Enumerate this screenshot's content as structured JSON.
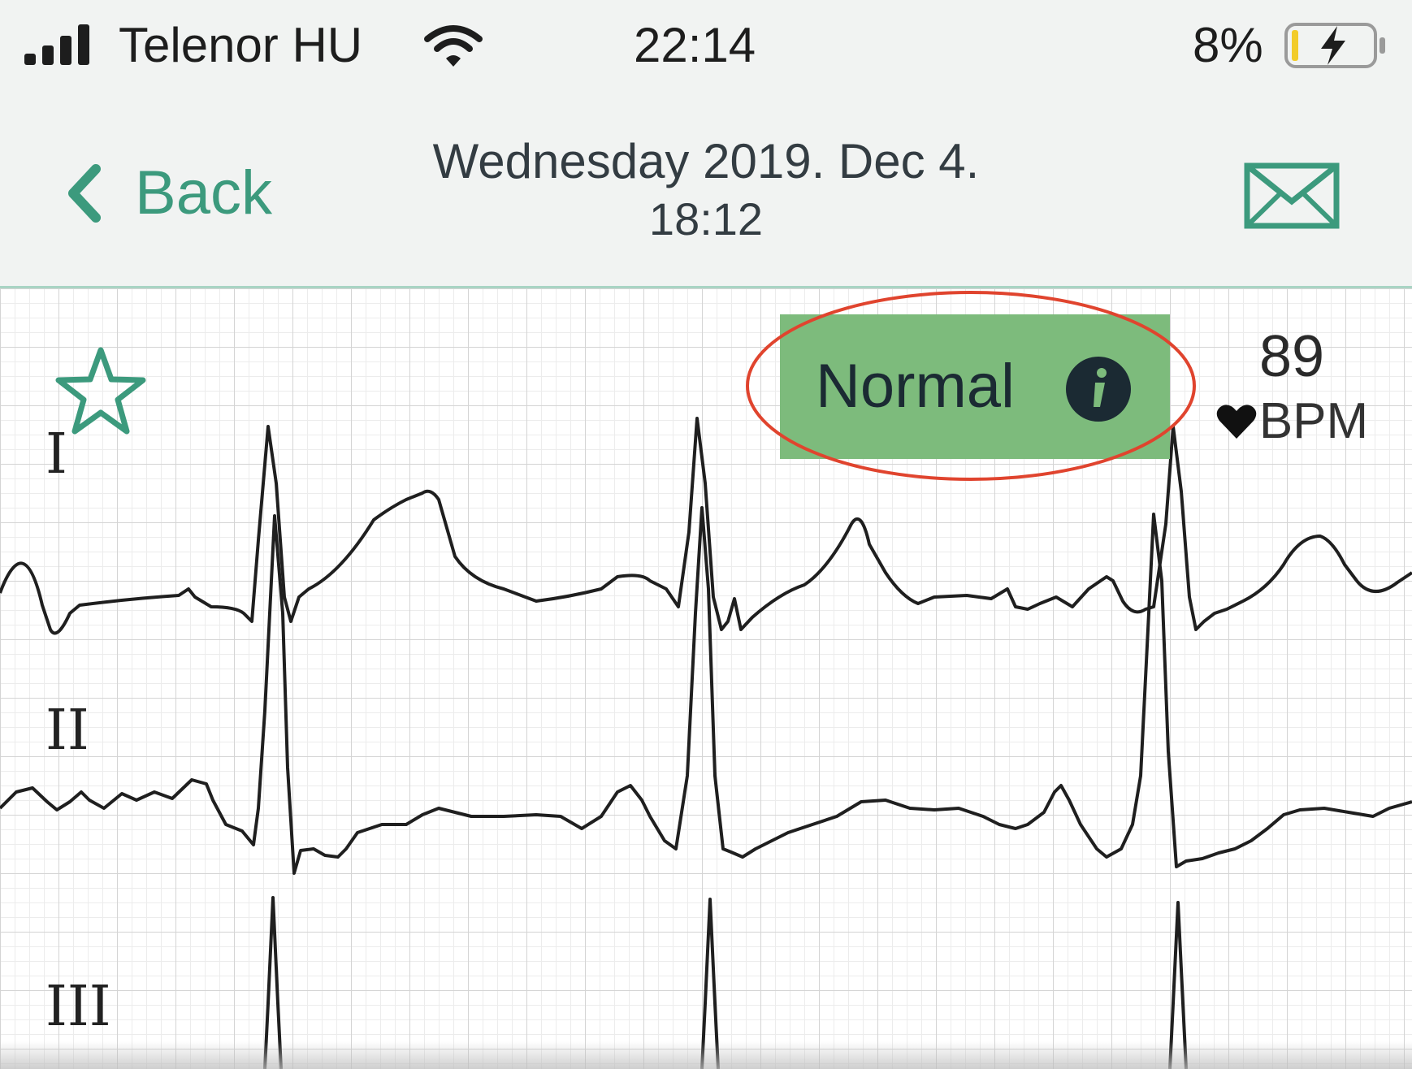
{
  "status_bar": {
    "carrier": "Telenor HU",
    "time": "22:14",
    "battery_percent": "8%",
    "battery_level": 0.08,
    "icons": [
      "signal-icon",
      "wifi-icon",
      "battery-charging-icon"
    ]
  },
  "nav_bar": {
    "back_label": "Back",
    "title_date": "Wednesday 2019. Dec 4.",
    "title_time": "18:12",
    "icons": [
      "chevron-left-icon",
      "mail-icon"
    ]
  },
  "recording": {
    "classification": "Normal",
    "heart_rate": "89",
    "heart_rate_unit": "BPM",
    "leads": [
      "I",
      "II",
      "III"
    ],
    "icons": [
      "star-icon",
      "info-icon",
      "heart-icon"
    ]
  },
  "colors": {
    "accent": "#3c9a7d",
    "badge": "#7dbb7c",
    "highlight": "#e0442e",
    "grid": "#d4d4d4",
    "trace": "#1f1f1f"
  }
}
